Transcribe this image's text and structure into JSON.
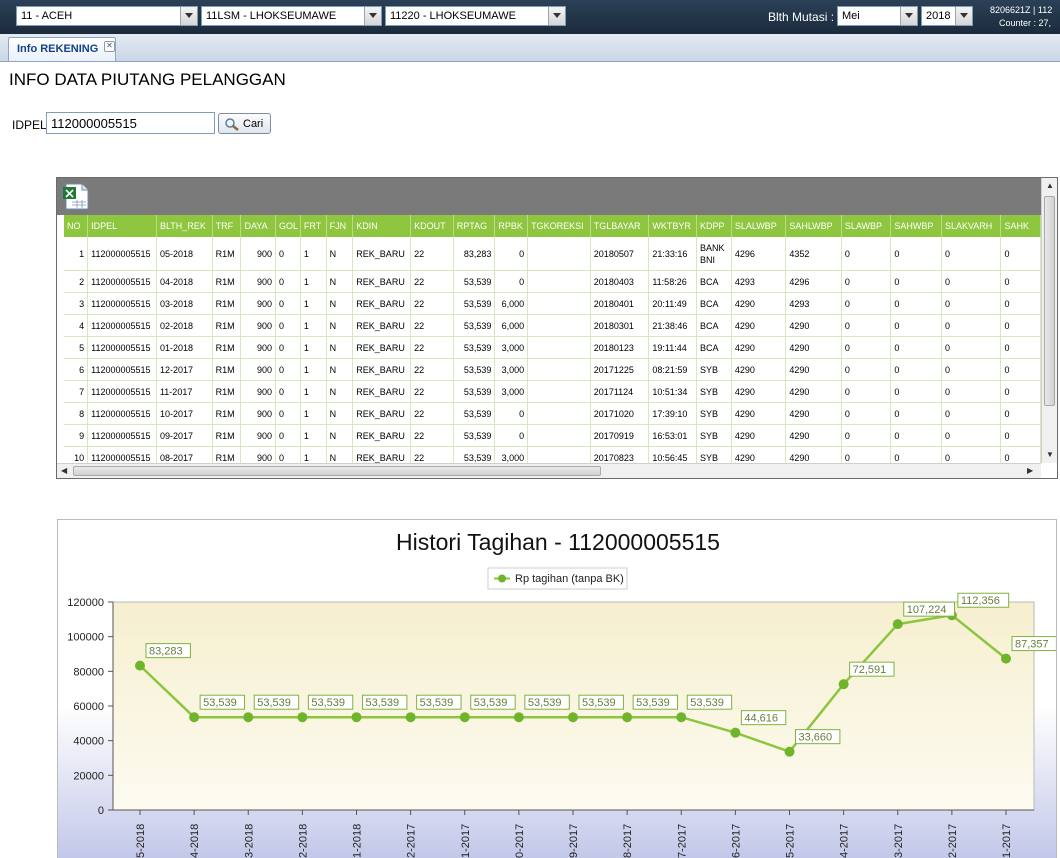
{
  "topbar": {
    "unit_select": "11 - ACEH",
    "area_select": "11LSM - LHOKSEUMAWE",
    "rayon_select": "11220 - LHOKSEUMAWE",
    "blth_label": "Blth Mutasi :",
    "month_select": "Mei",
    "year_select": "2018",
    "user_line1": "8206621Z | 112",
    "user_line2": "Counter : 27,"
  },
  "tabs": [
    {
      "label": "Info REKENING",
      "close": "✕"
    }
  ],
  "page": {
    "title": "INFO DATA PIUTANG PELANGGAN",
    "idpel_label": "IDPEL",
    "idpel_value": "112000005515",
    "search_button": "Cari"
  },
  "grid": {
    "columns": [
      "NO",
      "IDPEL",
      "BLTH_REK",
      "TRF",
      "DAYA",
      "GOL",
      "FRT",
      "FJN",
      "KDIN",
      "KDOUT",
      "RPTAG",
      "RPBK",
      "TGKOREKSI",
      "TGLBAYAR",
      "WKTBYR",
      "KDPP",
      "SLALWBP",
      "SAHLWBP",
      "SLAWBP",
      "SAHWBP",
      "SLAKVARH",
      "SAHK"
    ],
    "rows": [
      [
        "1",
        "112000005515",
        "05-2018",
        "R1M",
        "900",
        "0",
        "1",
        "N",
        "REK_BARU",
        "22",
        "83,283",
        "0",
        "",
        "20180507",
        "21:33:16",
        "BANK BNI",
        "4296",
        "4352",
        "0",
        "0",
        "0",
        "0"
      ],
      [
        "2",
        "112000005515",
        "04-2018",
        "R1M",
        "900",
        "0",
        "1",
        "N",
        "REK_BARU",
        "22",
        "53,539",
        "0",
        "",
        "20180403",
        "11:58:26",
        "BCA",
        "4293",
        "4296",
        "0",
        "0",
        "0",
        "0"
      ],
      [
        "3",
        "112000005515",
        "03-2018",
        "R1M",
        "900",
        "0",
        "1",
        "N",
        "REK_BARU",
        "22",
        "53,539",
        "6,000",
        "",
        "20180401",
        "20:11:49",
        "BCA",
        "4290",
        "4293",
        "0",
        "0",
        "0",
        "0"
      ],
      [
        "4",
        "112000005515",
        "02-2018",
        "R1M",
        "900",
        "0",
        "1",
        "N",
        "REK_BARU",
        "22",
        "53,539",
        "6,000",
        "",
        "20180301",
        "21:38:46",
        "BCA",
        "4290",
        "4290",
        "0",
        "0",
        "0",
        "0"
      ],
      [
        "5",
        "112000005515",
        "01-2018",
        "R1M",
        "900",
        "0",
        "1",
        "N",
        "REK_BARU",
        "22",
        "53,539",
        "3,000",
        "",
        "20180123",
        "19:11:44",
        "BCA",
        "4290",
        "4290",
        "0",
        "0",
        "0",
        "0"
      ],
      [
        "6",
        "112000005515",
        "12-2017",
        "R1M",
        "900",
        "0",
        "1",
        "N",
        "REK_BARU",
        "22",
        "53,539",
        "3,000",
        "",
        "20171225",
        "08:21:59",
        "SYB",
        "4290",
        "4290",
        "0",
        "0",
        "0",
        "0"
      ],
      [
        "7",
        "112000005515",
        "11-2017",
        "R1M",
        "900",
        "0",
        "1",
        "N",
        "REK_BARU",
        "22",
        "53,539",
        "3,000",
        "",
        "20171124",
        "10:51:34",
        "SYB",
        "4290",
        "4290",
        "0",
        "0",
        "0",
        "0"
      ],
      [
        "8",
        "112000005515",
        "10-2017",
        "R1M",
        "900",
        "0",
        "1",
        "N",
        "REK_BARU",
        "22",
        "53,539",
        "0",
        "",
        "20171020",
        "17:39:10",
        "SYB",
        "4290",
        "4290",
        "0",
        "0",
        "0",
        "0"
      ],
      [
        "9",
        "112000005515",
        "09-2017",
        "R1M",
        "900",
        "0",
        "1",
        "N",
        "REK_BARU",
        "22",
        "53,539",
        "0",
        "",
        "20170919",
        "16:53:01",
        "SYB",
        "4290",
        "4290",
        "0",
        "0",
        "0",
        "0"
      ],
      [
        "10",
        "112000005515",
        "08-2017",
        "R1M",
        "900",
        "0",
        "1",
        "N",
        "REK_BARU",
        "22",
        "53,539",
        "3,000",
        "",
        "20170823",
        "10:56:45",
        "SYB",
        "4290",
        "4290",
        "0",
        "0",
        "0",
        "0"
      ]
    ]
  },
  "colors": {
    "accent": "#8ec63f",
    "line": "#8cc63f",
    "point": "#6fb52c"
  },
  "chart_data": {
    "type": "line",
    "title": "Histori Tagihan - 112000005515",
    "legend": "top-center",
    "grid": false,
    "xlabel": "",
    "ylabel": "",
    "ylim": [
      0,
      120000
    ],
    "yticks": [
      "0",
      "20000",
      "40000",
      "60000",
      "80000",
      "100000",
      "120000"
    ],
    "x": [
      "5-2018",
      "4-2018",
      "3-2018",
      "2-2018",
      "1-2018",
      "2-2017",
      "1-2017",
      "0-2017",
      "9-2017",
      "8-2017",
      "7-2017",
      "6-2017",
      "5-2017",
      "4-2017",
      "3-2017",
      "2-2017",
      "1-2017"
    ],
    "series": [
      {
        "name": "Rp tagihan (tanpa BK)",
        "values": [
          83283,
          53539,
          53539,
          53539,
          53539,
          53539,
          53539,
          53539,
          53539,
          53539,
          53539,
          44616,
          33660,
          72591,
          107224,
          112356,
          87357
        ],
        "labels": [
          "83,283",
          "53,539",
          "53,539",
          "53,539",
          "53,539",
          "53,539",
          "53,539",
          "53,539",
          "53,539",
          "53,539",
          "53,539",
          "44,616",
          "33,660",
          "72,591",
          "107,224",
          "112,356",
          "87,357"
        ]
      }
    ]
  }
}
